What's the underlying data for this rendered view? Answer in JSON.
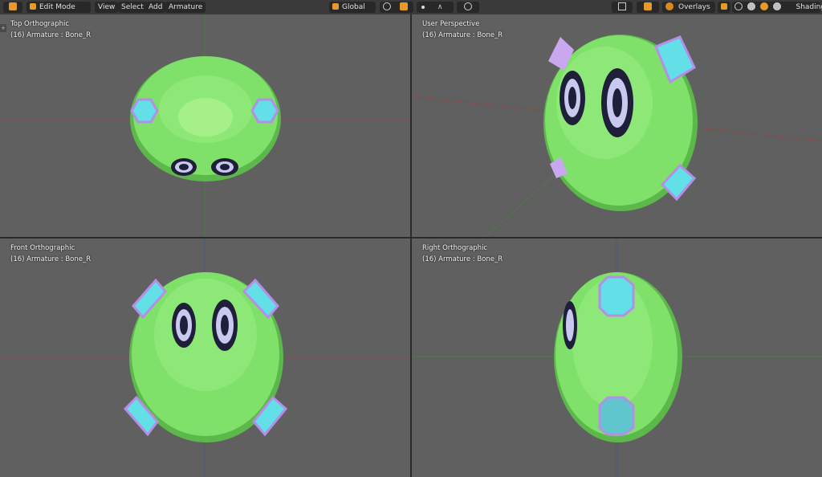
{
  "header": {
    "mode": "Edit Mode",
    "menus": [
      "View",
      "Select",
      "Add",
      "Armature"
    ],
    "orientation": "Global",
    "overlays_label": "Overlays",
    "shading_label": "Shading"
  },
  "viewports": [
    {
      "title": "Top Orthographic",
      "subtitle": "(16) Armature : Bone_R"
    },
    {
      "title": "User Perspective",
      "subtitle": "(16) Armature : Bone_R"
    },
    {
      "title": "Front Orthographic",
      "subtitle": "(16) Armature : Bone_R"
    },
    {
      "title": "Right Orthographic",
      "subtitle": "(16) Armature : Bone_R"
    }
  ],
  "colors": {
    "body_green": "#7fe06a",
    "body_dark": "#5cb84a",
    "accent_cyan": "#63dfe8",
    "eye_dark": "#1f1f3a",
    "header_accent": "#e59a2b"
  }
}
